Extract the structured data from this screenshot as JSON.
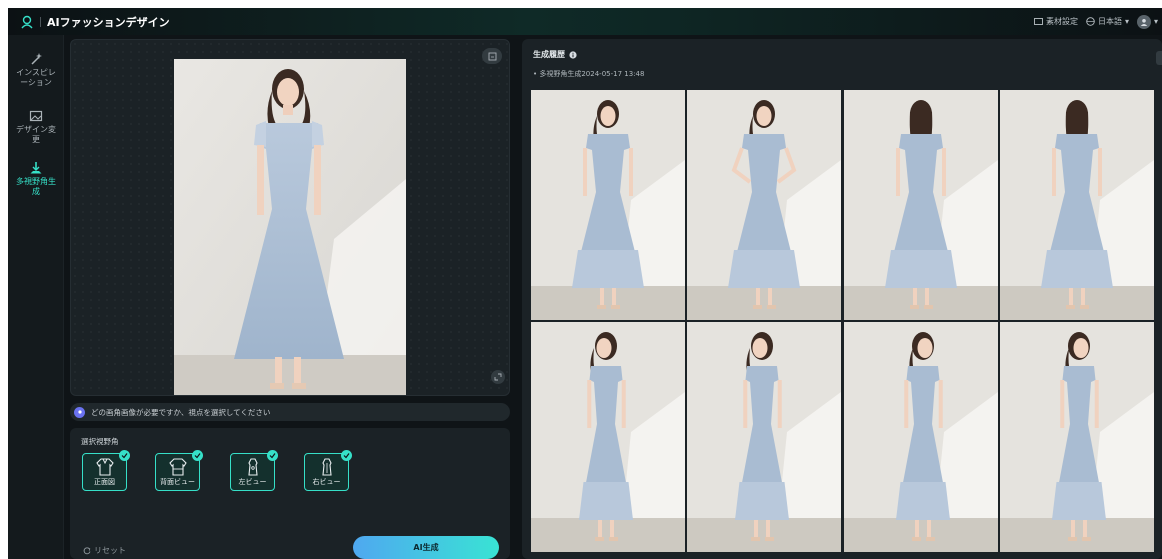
{
  "header": {
    "app_title": "AIファッションデザイン",
    "materials_label": "素材設定",
    "language_label": "日本語",
    "colors": {
      "accent": "#36e0c8"
    }
  },
  "sidebar": {
    "items": [
      {
        "label": "インスピレーション",
        "icon": "magic-wand-icon",
        "active": false
      },
      {
        "label": "デザイン変更",
        "icon": "image-edit-icon",
        "active": false
      },
      {
        "label": "多視野角生成",
        "icon": "multi-view-icon",
        "active": true
      }
    ]
  },
  "editor": {
    "prompt_text": "どの画角画像が必要ですか、視点を選択してください",
    "view_section_title": "選択視野角",
    "view_options": [
      {
        "label": "正面図",
        "icon": "front-view-shirt-icon",
        "selected": true
      },
      {
        "label": "背面ビュー",
        "icon": "back-view-shirt-icon",
        "selected": true
      },
      {
        "label": "左ビュー",
        "icon": "left-view-shirt-icon",
        "selected": true
      },
      {
        "label": "右ビュー",
        "icon": "right-view-shirt-icon",
        "selected": true
      }
    ],
    "reset_label": "リセット",
    "generate_label": "AI生成"
  },
  "history": {
    "title": "生成履歴",
    "entry_label": "• 多視野角生成2024-05-17 13:48",
    "views": [
      "front",
      "front-arms",
      "back",
      "back",
      "left",
      "left",
      "right",
      "right"
    ]
  }
}
